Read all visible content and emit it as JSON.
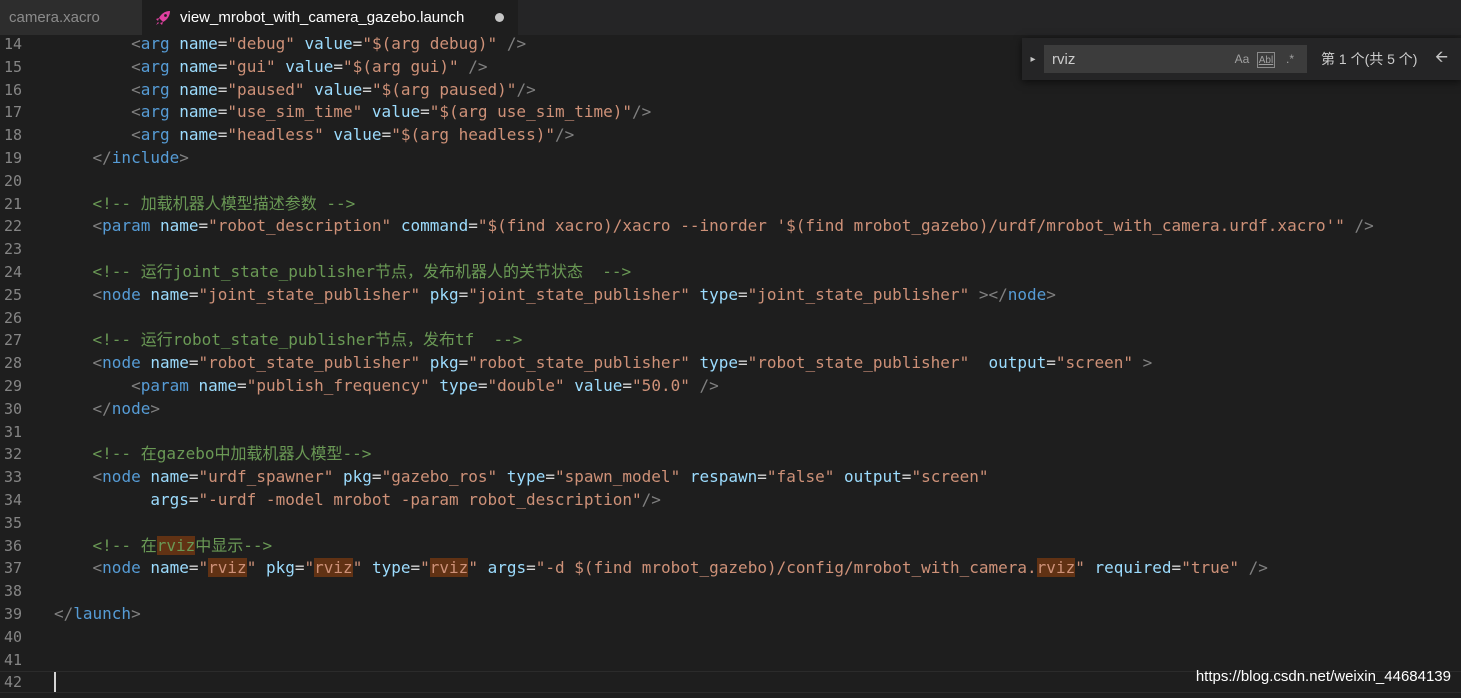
{
  "tabs": [
    {
      "label": "camera.xacro",
      "active": false
    },
    {
      "label": "view_mrobot_with_camera_gazebo.launch",
      "active": true,
      "dirty": true
    }
  ],
  "find": {
    "query": "rviz",
    "match_case_label": "Aa",
    "whole_word_label": "Abl",
    "regex_label": ".*",
    "result_text": "第 1 个(共 5 个)",
    "prev_icon": "arrow-left-icon",
    "toggle_icon": "chevron-right-icon"
  },
  "editor": {
    "language": "xml",
    "cursor_line": 42,
    "lines": [
      {
        "n": "14",
        "tokens": [
          [
            "punc",
            "        <"
          ],
          [
            "tag",
            "arg"
          ],
          [
            "plain",
            " "
          ],
          [
            "attr",
            "name"
          ],
          [
            "plain",
            "="
          ],
          [
            "str",
            "\"debug\""
          ],
          [
            "plain",
            " "
          ],
          [
            "attr",
            "value"
          ],
          [
            "plain",
            "="
          ],
          [
            "str",
            "\"$(arg debug)\""
          ],
          [
            "plain",
            " "
          ],
          [
            "punc",
            "/>"
          ]
        ]
      },
      {
        "n": "15",
        "tokens": [
          [
            "punc",
            "        <"
          ],
          [
            "tag",
            "arg"
          ],
          [
            "plain",
            " "
          ],
          [
            "attr",
            "name"
          ],
          [
            "plain",
            "="
          ],
          [
            "str",
            "\"gui\""
          ],
          [
            "plain",
            " "
          ],
          [
            "attr",
            "value"
          ],
          [
            "plain",
            "="
          ],
          [
            "str",
            "\"$(arg gui)\""
          ],
          [
            "plain",
            " "
          ],
          [
            "punc",
            "/>"
          ]
        ]
      },
      {
        "n": "16",
        "tokens": [
          [
            "punc",
            "        <"
          ],
          [
            "tag",
            "arg"
          ],
          [
            "plain",
            " "
          ],
          [
            "attr",
            "name"
          ],
          [
            "plain",
            "="
          ],
          [
            "str",
            "\"paused\""
          ],
          [
            "plain",
            " "
          ],
          [
            "attr",
            "value"
          ],
          [
            "plain",
            "="
          ],
          [
            "str",
            "\"$(arg paused)\""
          ],
          [
            "punc",
            "/>"
          ]
        ]
      },
      {
        "n": "17",
        "tokens": [
          [
            "punc",
            "        <"
          ],
          [
            "tag",
            "arg"
          ],
          [
            "plain",
            " "
          ],
          [
            "attr",
            "name"
          ],
          [
            "plain",
            "="
          ],
          [
            "str",
            "\"use_sim_time\""
          ],
          [
            "plain",
            " "
          ],
          [
            "attr",
            "value"
          ],
          [
            "plain",
            "="
          ],
          [
            "str",
            "\"$(arg use_sim_time)\""
          ],
          [
            "punc",
            "/>"
          ]
        ]
      },
      {
        "n": "18",
        "tokens": [
          [
            "punc",
            "        <"
          ],
          [
            "tag",
            "arg"
          ],
          [
            "plain",
            " "
          ],
          [
            "attr",
            "name"
          ],
          [
            "plain",
            "="
          ],
          [
            "str",
            "\"headless\""
          ],
          [
            "plain",
            " "
          ],
          [
            "attr",
            "value"
          ],
          [
            "plain",
            "="
          ],
          [
            "str",
            "\"$(arg headless)\""
          ],
          [
            "punc",
            "/>"
          ]
        ]
      },
      {
        "n": "19",
        "tokens": [
          [
            "punc",
            "    </"
          ],
          [
            "tag",
            "include"
          ],
          [
            "punc",
            ">"
          ]
        ]
      },
      {
        "n": "20",
        "tokens": []
      },
      {
        "n": "21",
        "tokens": [
          [
            "com",
            "    <!-- 加载机器人模型描述参数 -->"
          ]
        ]
      },
      {
        "n": "22",
        "tokens": [
          [
            "punc",
            "    <"
          ],
          [
            "tag",
            "param"
          ],
          [
            "plain",
            " "
          ],
          [
            "attr",
            "name"
          ],
          [
            "plain",
            "="
          ],
          [
            "str",
            "\"robot_description\""
          ],
          [
            "plain",
            " "
          ],
          [
            "attr",
            "command"
          ],
          [
            "plain",
            "="
          ],
          [
            "str",
            "\"$(find xacro)/xacro --inorder '$(find mrobot_gazebo)/urdf/mrobot_with_camera.urdf.xacro'\""
          ],
          [
            "plain",
            " "
          ],
          [
            "punc",
            "/>"
          ]
        ]
      },
      {
        "n": "23",
        "tokens": []
      },
      {
        "n": "24",
        "tokens": [
          [
            "com",
            "    <!-- 运行joint_state_publisher节点，发布机器人的关节状态  -->"
          ]
        ]
      },
      {
        "n": "25",
        "tokens": [
          [
            "punc",
            "    <"
          ],
          [
            "tag",
            "node"
          ],
          [
            "plain",
            " "
          ],
          [
            "attr",
            "name"
          ],
          [
            "plain",
            "="
          ],
          [
            "str",
            "\"joint_state_publisher\""
          ],
          [
            "plain",
            " "
          ],
          [
            "attr",
            "pkg"
          ],
          [
            "plain",
            "="
          ],
          [
            "str",
            "\"joint_state_publisher\""
          ],
          [
            "plain",
            " "
          ],
          [
            "attr",
            "type"
          ],
          [
            "plain",
            "="
          ],
          [
            "str",
            "\"joint_state_publisher\""
          ],
          [
            "plain",
            " "
          ],
          [
            "punc",
            "></"
          ],
          [
            "tag",
            "node"
          ],
          [
            "punc",
            ">"
          ]
        ]
      },
      {
        "n": "26",
        "tokens": []
      },
      {
        "n": "27",
        "tokens": [
          [
            "com",
            "    <!-- 运行robot_state_publisher节点，发布tf  -->"
          ]
        ]
      },
      {
        "n": "28",
        "tokens": [
          [
            "punc",
            "    <"
          ],
          [
            "tag",
            "node"
          ],
          [
            "plain",
            " "
          ],
          [
            "attr",
            "name"
          ],
          [
            "plain",
            "="
          ],
          [
            "str",
            "\"robot_state_publisher\""
          ],
          [
            "plain",
            " "
          ],
          [
            "attr",
            "pkg"
          ],
          [
            "plain",
            "="
          ],
          [
            "str",
            "\"robot_state_publisher\""
          ],
          [
            "plain",
            " "
          ],
          [
            "attr",
            "type"
          ],
          [
            "plain",
            "="
          ],
          [
            "str",
            "\"robot_state_publisher\""
          ],
          [
            "plain",
            "  "
          ],
          [
            "attr",
            "output"
          ],
          [
            "plain",
            "="
          ],
          [
            "str",
            "\"screen\""
          ],
          [
            "plain",
            " "
          ],
          [
            "punc",
            ">"
          ]
        ]
      },
      {
        "n": "29",
        "tokens": [
          [
            "punc",
            "        <"
          ],
          [
            "tag",
            "param"
          ],
          [
            "plain",
            " "
          ],
          [
            "attr",
            "name"
          ],
          [
            "plain",
            "="
          ],
          [
            "str",
            "\"publish_frequency\""
          ],
          [
            "plain",
            " "
          ],
          [
            "attr",
            "type"
          ],
          [
            "plain",
            "="
          ],
          [
            "str",
            "\"double\""
          ],
          [
            "plain",
            " "
          ],
          [
            "attr",
            "value"
          ],
          [
            "plain",
            "="
          ],
          [
            "str",
            "\"50.0\""
          ],
          [
            "plain",
            " "
          ],
          [
            "punc",
            "/>"
          ]
        ]
      },
      {
        "n": "30",
        "tokens": [
          [
            "punc",
            "    </"
          ],
          [
            "tag",
            "node"
          ],
          [
            "punc",
            ">"
          ]
        ]
      },
      {
        "n": "31",
        "tokens": []
      },
      {
        "n": "32",
        "tokens": [
          [
            "com",
            "    <!-- 在gazebo中加载机器人模型-->"
          ]
        ]
      },
      {
        "n": "33",
        "tokens": [
          [
            "punc",
            "    <"
          ],
          [
            "tag",
            "node"
          ],
          [
            "plain",
            " "
          ],
          [
            "attr",
            "name"
          ],
          [
            "plain",
            "="
          ],
          [
            "str",
            "\"urdf_spawner\""
          ],
          [
            "plain",
            " "
          ],
          [
            "attr",
            "pkg"
          ],
          [
            "plain",
            "="
          ],
          [
            "str",
            "\"gazebo_ros\""
          ],
          [
            "plain",
            " "
          ],
          [
            "attr",
            "type"
          ],
          [
            "plain",
            "="
          ],
          [
            "str",
            "\"spawn_model\""
          ],
          [
            "plain",
            " "
          ],
          [
            "attr",
            "respawn"
          ],
          [
            "plain",
            "="
          ],
          [
            "str",
            "\"false\""
          ],
          [
            "plain",
            " "
          ],
          [
            "attr",
            "output"
          ],
          [
            "plain",
            "="
          ],
          [
            "str",
            "\"screen\""
          ]
        ]
      },
      {
        "n": "34",
        "tokens": [
          [
            "plain",
            "          "
          ],
          [
            "attr",
            "args"
          ],
          [
            "plain",
            "="
          ],
          [
            "str",
            "\"-urdf -model mrobot -param robot_description\""
          ],
          [
            "punc",
            "/>"
          ]
        ]
      },
      {
        "n": "35",
        "tokens": []
      },
      {
        "n": "36",
        "tokens": [
          [
            "com",
            "    <!-- 在"
          ],
          [
            "comhl",
            "rviz"
          ],
          [
            "com",
            "中显示-->"
          ]
        ]
      },
      {
        "n": "37",
        "tokens": [
          [
            "punc",
            "    <"
          ],
          [
            "tag",
            "node"
          ],
          [
            "plain",
            " "
          ],
          [
            "attr",
            "name"
          ],
          [
            "plain",
            "="
          ],
          [
            "str",
            "\""
          ],
          [
            "strhl",
            "rviz"
          ],
          [
            "str",
            "\""
          ],
          [
            "plain",
            " "
          ],
          [
            "attr",
            "pkg"
          ],
          [
            "plain",
            "="
          ],
          [
            "str",
            "\""
          ],
          [
            "strhl",
            "rviz"
          ],
          [
            "str",
            "\""
          ],
          [
            "plain",
            " "
          ],
          [
            "attr",
            "type"
          ],
          [
            "plain",
            "="
          ],
          [
            "str",
            "\""
          ],
          [
            "strhl",
            "rviz"
          ],
          [
            "str",
            "\""
          ],
          [
            "plain",
            " "
          ],
          [
            "attr",
            "args"
          ],
          [
            "plain",
            "="
          ],
          [
            "str",
            "\"-d $(find mrobot_gazebo)/config/mrobot_with_camera."
          ],
          [
            "strhl",
            "rviz"
          ],
          [
            "str",
            "\""
          ],
          [
            "plain",
            " "
          ],
          [
            "attr",
            "required"
          ],
          [
            "plain",
            "="
          ],
          [
            "str",
            "\"true\""
          ],
          [
            "plain",
            " "
          ],
          [
            "punc",
            "/>"
          ]
        ]
      },
      {
        "n": "38",
        "tokens": []
      },
      {
        "n": "39",
        "tokens": [
          [
            "punc",
            "</"
          ],
          [
            "tag",
            "launch"
          ],
          [
            "punc",
            ">"
          ]
        ]
      },
      {
        "n": "40",
        "tokens": []
      },
      {
        "n": "41",
        "tokens": []
      },
      {
        "n": "42",
        "tokens": []
      }
    ]
  },
  "watermark": "https://blog.csdn.net/weixin_44684139",
  "colors": {
    "background": "#1e1e1e",
    "tag": "#569cd6",
    "attribute": "#9cdcfe",
    "string": "#ce9178",
    "comment": "#6a9955",
    "match_highlight": "#613214"
  }
}
